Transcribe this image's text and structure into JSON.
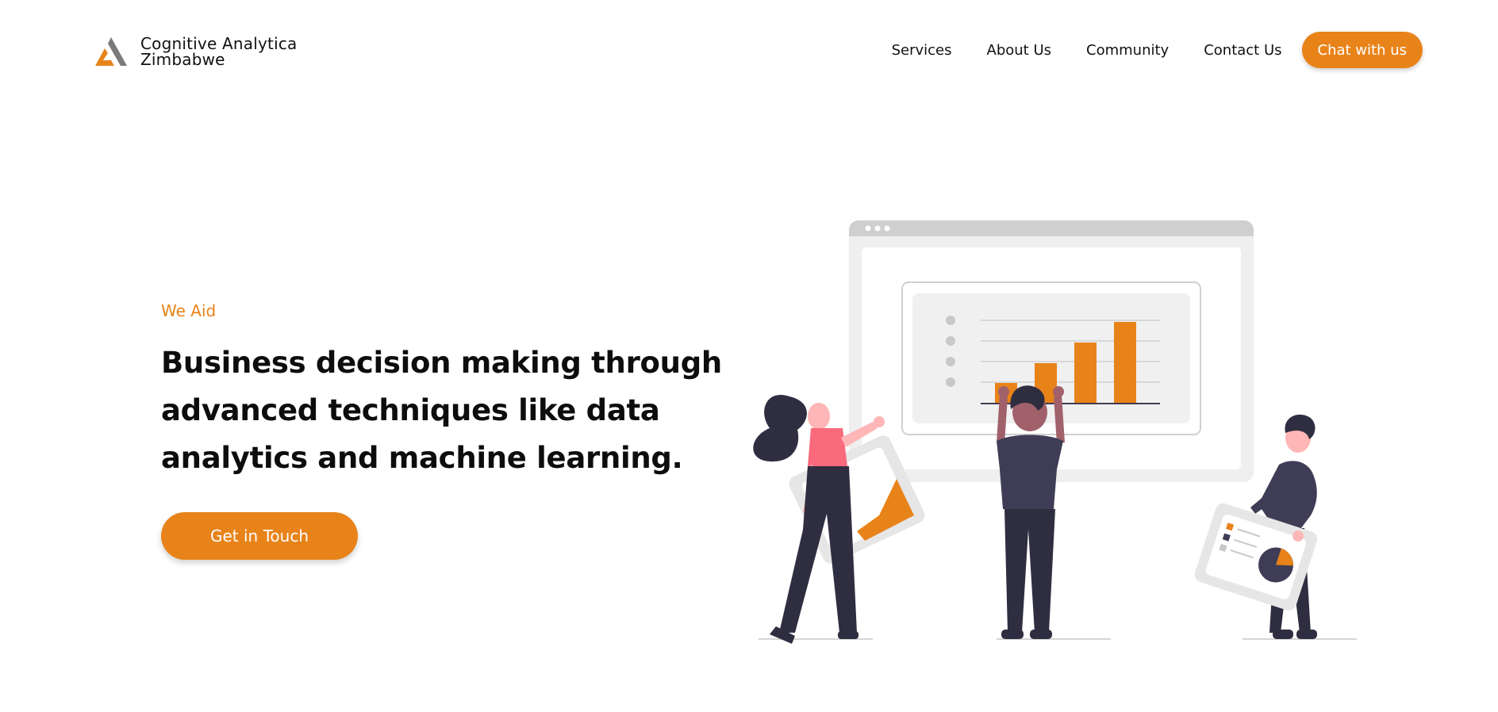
{
  "brand": {
    "name_line1": "Cognitive Analytica",
    "name_line2": "Zimbabwe",
    "accent_color": "#e8831a"
  },
  "nav": {
    "items": [
      {
        "label": "Services"
      },
      {
        "label": "About Us"
      },
      {
        "label": "Community"
      },
      {
        "label": "Contact Us"
      }
    ],
    "chat_label": "Chat with us"
  },
  "hero": {
    "eyebrow": "We Aid",
    "headline_line1": "Business decision making through",
    "headline_line2": "advanced techniques like data",
    "headline_line3": "analytics and machine learning.",
    "cta_label": "Get in Touch"
  },
  "illustration": {
    "icon": "team-analytics-illustration"
  }
}
